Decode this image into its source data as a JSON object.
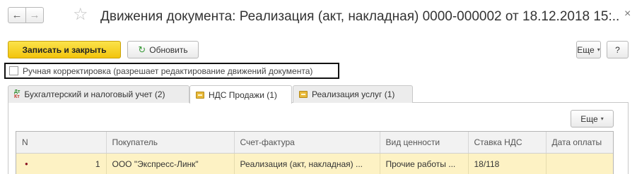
{
  "titlebar": {
    "back_icon": "arrow-left-icon",
    "forward_icon": "arrow-right-icon",
    "favorite_icon": "star-icon",
    "title": "Движения документа: Реализация (акт, накладная) 0000-000002 от 18.12.2018 15:...",
    "close_icon": "close-icon",
    "back_glyph": "←",
    "forward_glyph": "→",
    "star_glyph": "☆",
    "close_glyph": "×"
  },
  "toolbar": {
    "save_close_label": "Записать и закрыть",
    "refresh_label": "Обновить",
    "refresh_glyph": "↻",
    "more_label": "Еще",
    "caret_glyph": "▾",
    "help_label": "?"
  },
  "manual_edit": {
    "label": "Ручная корректировка (разрешает редактирование движений документа)",
    "checked": false
  },
  "tabs": [
    {
      "label": "Бухгалтерский и налоговый учет (2)",
      "icon": "dt-kt-icon",
      "icon_dt": "Дт",
      "icon_kt": "Кт",
      "active": false
    },
    {
      "label": "НДС Продажи (1)",
      "icon": "register-icon",
      "active": true
    },
    {
      "label": "Реализация услуг (1)",
      "icon": "register-icon",
      "active": false
    }
  ],
  "panel": {
    "more_label": "Еще"
  },
  "table": {
    "columns": [
      "N",
      "Покупатель",
      "Счет-фактура",
      "Вид ценности",
      "Ставка НДС",
      "Дата оплаты"
    ],
    "rows": [
      {
        "marker": "●",
        "n": "1",
        "buyer": "ООО \"Экспресс-Линк\"",
        "invoice": "Реализация (акт, накладная) ...",
        "value_type": "Прочие работы ...",
        "vat_rate": "18/118",
        "pay_date": ""
      }
    ]
  }
}
